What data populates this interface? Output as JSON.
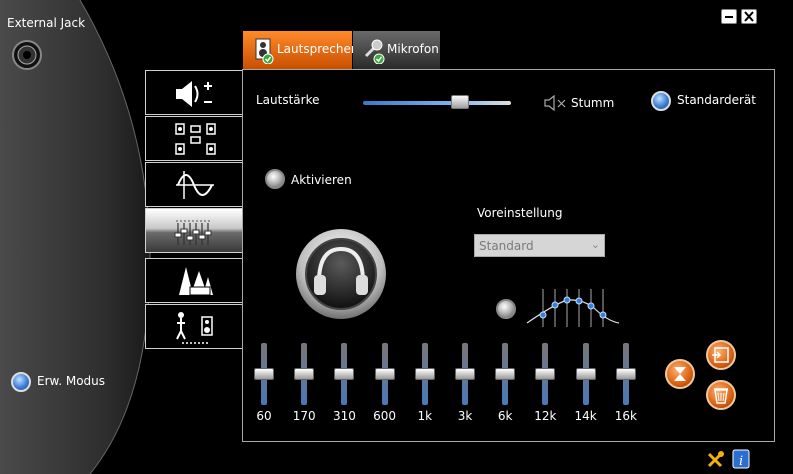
{
  "jack": {
    "label": "External Jack"
  },
  "tabs": [
    {
      "label": "Lautsprecher",
      "active": true
    },
    {
      "label": "Mikrofon",
      "active": false
    }
  ],
  "nav": [
    {
      "name": "speaker-config",
      "icon": "speaker-volume-icon",
      "selected": false
    },
    {
      "name": "speaker-layout",
      "icon": "surround-speakers-icon",
      "selected": false
    },
    {
      "name": "sound-effects",
      "icon": "waveform-icon",
      "selected": false
    },
    {
      "name": "equalizer",
      "icon": "equalizer-icon",
      "selected": true
    },
    {
      "name": "environment",
      "icon": "environment-icon",
      "selected": false
    },
    {
      "name": "room-correction",
      "icon": "room-correction-icon",
      "selected": false
    }
  ],
  "volume": {
    "label": "Lautstärke",
    "mute_label": "Stumm",
    "level": 0.68
  },
  "default_device": {
    "label": "Standarderät"
  },
  "enable": {
    "label": "Aktivieren"
  },
  "preset": {
    "label": "Voreinstellung",
    "value": "Standard"
  },
  "eq": {
    "bands": [
      "60",
      "170",
      "310",
      "600",
      "1k",
      "3k",
      "6k",
      "12k",
      "14k",
      "16k"
    ],
    "levels": [
      0.5,
      0.5,
      0.5,
      0.5,
      0.5,
      0.5,
      0.5,
      0.5,
      0.5,
      0.5
    ]
  },
  "advanced_mode": {
    "label": "Erw. Modus"
  },
  "colors": {
    "accent_orange": "#e06a10",
    "radio_blue": "#3b7fd4"
  }
}
